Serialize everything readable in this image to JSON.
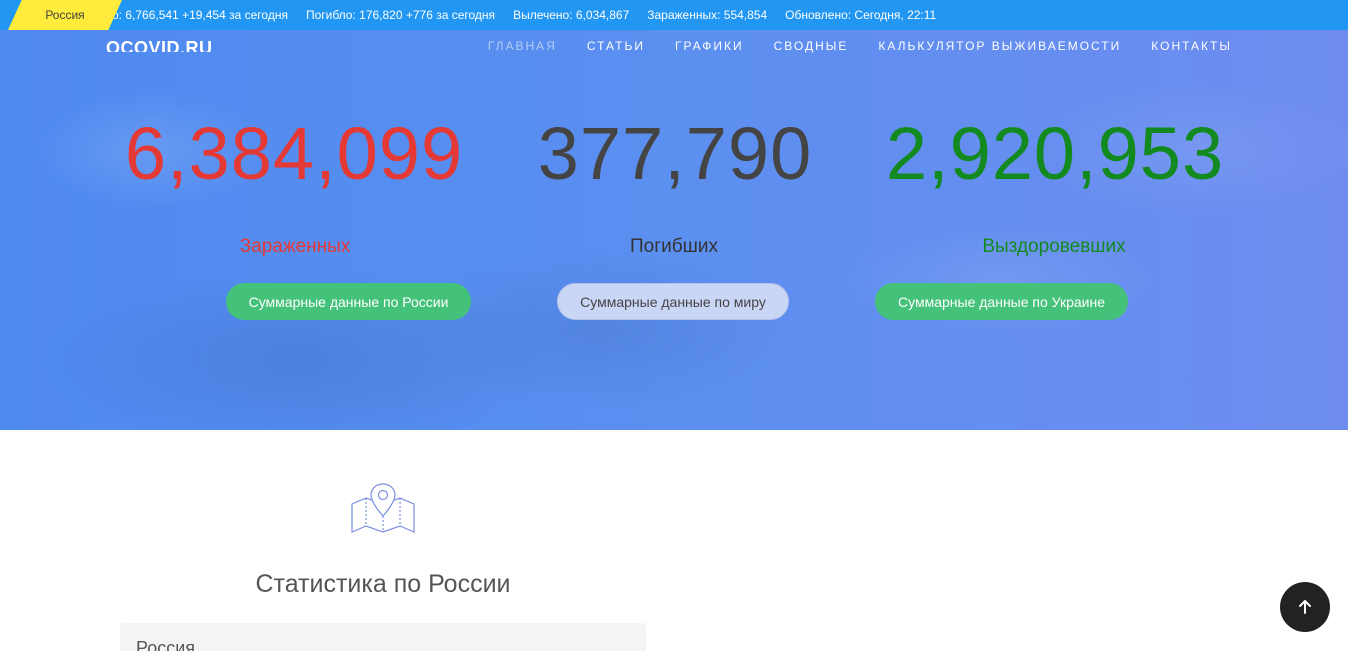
{
  "ticker": {
    "label": "Россия",
    "items": [
      "о: 6,766,541 +19,454 за сегодня",
      "Погибло: 176,820 +776 за сегодня",
      "Вылечено: 6,034,867",
      "Зараженных: 554,854",
      "Обновлено: Сегодня, 22:11"
    ]
  },
  "logo": "OCOVID.RU",
  "nav": [
    "ГЛАВНАЯ",
    "СТАТЬИ",
    "ГРАФИКИ",
    "СВОДНЫЕ",
    "КАЛЬКУЛЯТОР ВЫЖИВАЕМОСТИ",
    "КОНТАКТЫ"
  ],
  "stats": {
    "infected": {
      "value": "6,384,099",
      "label": "Зараженных",
      "color": "#e53935"
    },
    "deaths": {
      "value": "377,790",
      "label": "Погибших",
      "color": "#444444"
    },
    "recovered": {
      "value": "2,920,953",
      "label": "Выздоровевших",
      "color": "#138a1f"
    }
  },
  "buttons": {
    "russia": "Суммарные данные по России",
    "world": "Суммарные данные по миру",
    "ukraine": "Суммарные данные по Украине"
  },
  "section": {
    "icon": "map-pin-icon",
    "title": "Статистика по России",
    "select_value": "Россия"
  },
  "back_to_top_icon": "arrow-up-icon",
  "colors": {
    "ticker_bg": "#2196f3",
    "ticker_label_bg": "#ffeb3b",
    "accent_green": "#45c27a"
  }
}
